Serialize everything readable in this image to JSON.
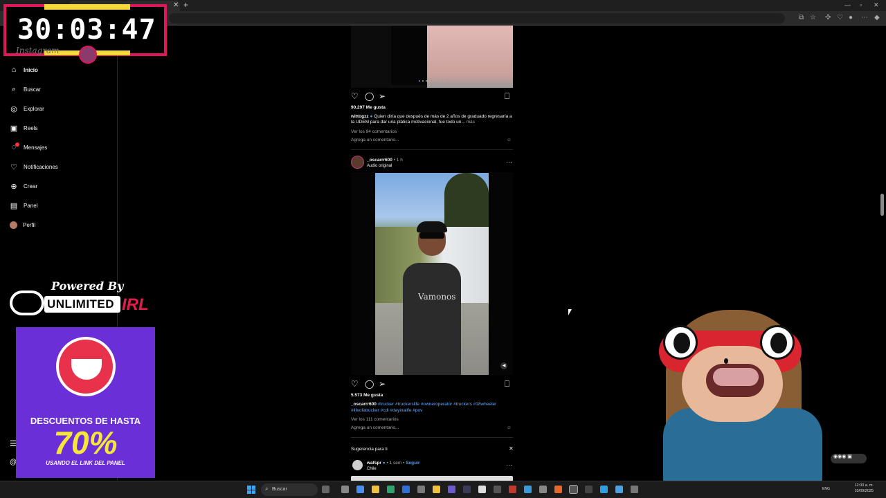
{
  "timer": {
    "text": "30:03:47"
  },
  "sidebar": {
    "logo_text": "Instagram",
    "items": [
      {
        "label": "Inicio",
        "icon": "home-icon"
      },
      {
        "label": "Buscar",
        "icon": "search-icon"
      },
      {
        "label": "Explorar",
        "icon": "compass-icon"
      },
      {
        "label": "Reels",
        "icon": "reels-icon"
      },
      {
        "label": "Mensajes",
        "icon": "messenger-icon",
        "badge": "8"
      },
      {
        "label": "Notificaciones",
        "icon": "heart-icon"
      },
      {
        "label": "Crear",
        "icon": "plus-icon"
      },
      {
        "label": "Panel",
        "icon": "chart-icon"
      },
      {
        "label": "Perfil",
        "icon": "avatar-icon"
      }
    ]
  },
  "sponsor": {
    "powered_by": "Powered By",
    "brand_main": "UNLIMITED",
    "brand_suffix": "IRL"
  },
  "promo": {
    "line1": "DESCUENTOS DE HASTA",
    "line2": "70%",
    "line3": "USANDO EL LINK DEL PANEL",
    "brand": "eneba"
  },
  "post1": {
    "likes": "90.297 Me gusta",
    "username": "wittogzz",
    "caption": "Quien diría que después de más de 2 años de graduado regresaría a la UDEM para dar una plática motivacional, fue todo un...",
    "more": "más",
    "comments_link": "Ver los 94 comentarios",
    "comment_placeholder": "Agrega un comentario..."
  },
  "post2": {
    "username": "_oscarrr600",
    "time": "• 1 h",
    "audio": "Audio original",
    "shirt_text": "Vamonos",
    "likes": "5.573 Me gusta",
    "caption_user": "_oscarrr600",
    "hashtags_line1": "#trucker #truckerslife #owneroperator #truckers #18wheeler",
    "hashtags_line2": "#lifeofatrucker #cdl #dayinalife #pov",
    "comments_link": "Ver los 111 comentarios",
    "comment_placeholder": "Agrega un comentario..."
  },
  "suggestion": {
    "header": "Sugerencia para ti",
    "username": "wafspr",
    "time": "• 1 sem •",
    "follow": "Seguir",
    "location": "Chile"
  },
  "taskbar": {
    "search_placeholder": "Buscar",
    "language": "ENG",
    "time": "12:03 a. m.",
    "date": "10/09/2025"
  },
  "colors": {
    "timer_border": "#e0155b",
    "timer_stripe": "#f5d93a",
    "promo_bg": "#6a2fd6",
    "promo_highlight": "#f5e63a",
    "hashtag": "#6aa8ff",
    "notification_badge": "#ff3040"
  }
}
